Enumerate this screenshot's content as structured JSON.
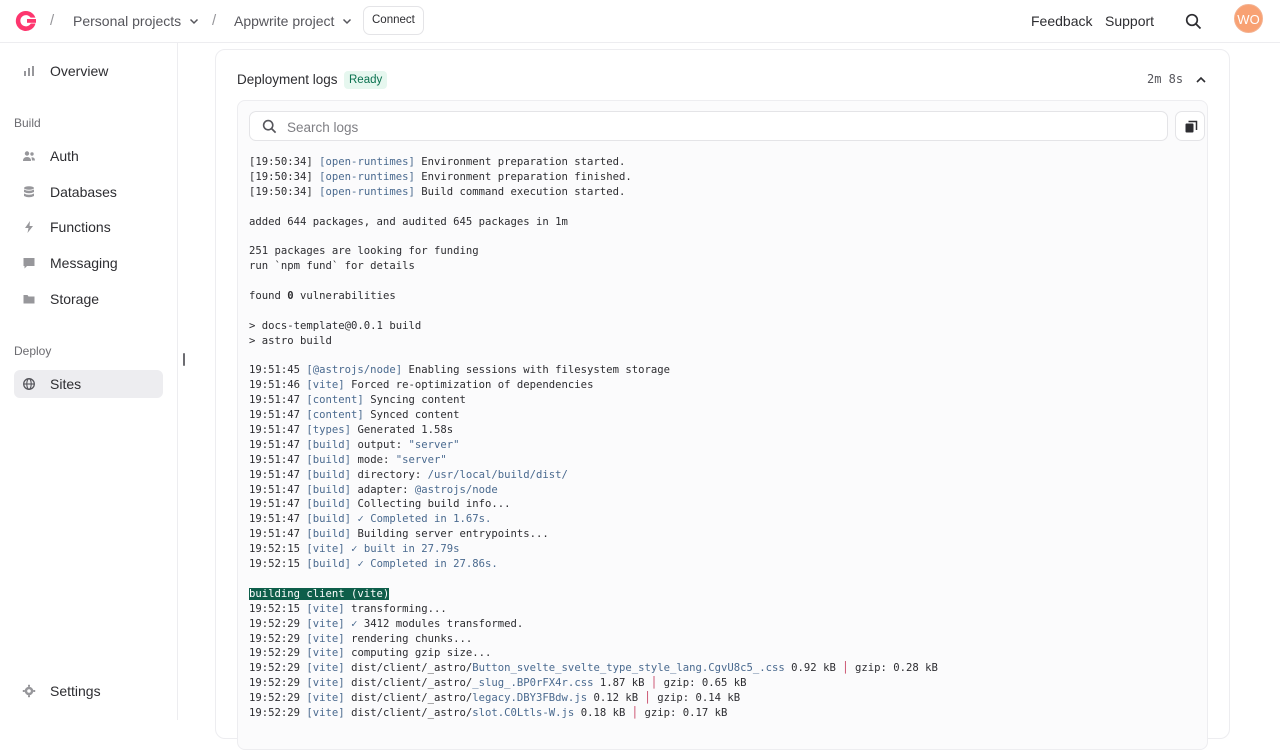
{
  "header": {
    "crumbs": [
      "Personal projects",
      "Appwrite project"
    ],
    "connect_label": "Connect",
    "feedback": "Feedback",
    "support": "Support",
    "avatar_initials": "WO"
  },
  "sidebar": {
    "overview": "Overview",
    "build_section": "Build",
    "items": [
      "Auth",
      "Databases",
      "Functions",
      "Messaging",
      "Storage"
    ],
    "deploy_section": "Deploy",
    "sites": "Sites",
    "settings": "Settings"
  },
  "deployment": {
    "title": "Deployment logs",
    "status": "Ready",
    "duration": "2m 8s",
    "search_placeholder": "Search logs"
  },
  "logs": [
    {
      "ts": "[19:50:34]",
      "tag": "[open-runtimes]",
      "msg": "Environment preparation started."
    },
    {
      "ts": "[19:50:34]",
      "tag": "[open-runtimes]",
      "msg": "Environment preparation finished."
    },
    {
      "ts": "[19:50:34]",
      "tag": "[open-runtimes]",
      "msg": "Build command execution started."
    },
    {
      "blank": true
    },
    {
      "msg": "added 644 packages, and audited 645 packages in 1m"
    },
    {
      "blank": true
    },
    {
      "msg": "251 packages are looking for funding"
    },
    {
      "msg": "run `npm fund` for details"
    },
    {
      "blank": true
    },
    {
      "msg": "found ",
      "bold": "0",
      "msg2": " vulnerabilities"
    },
    {
      "blank": true
    },
    {
      "msg": "> docs-template@0.0.1 build"
    },
    {
      "msg": "> astro build"
    },
    {
      "blank": true
    },
    {
      "ts": "19:51:45",
      "tag": "[@astrojs/node]",
      "msg": "Enabling sessions with filesystem storage"
    },
    {
      "ts": "19:51:46",
      "tag": "[vite]",
      "msg": "Forced re-optimization of dependencies"
    },
    {
      "ts": "19:51:47",
      "tag": "[content]",
      "msg": "Syncing content"
    },
    {
      "ts": "19:51:47",
      "tag": "[content]",
      "msg": "Synced content"
    },
    {
      "ts": "19:51:47",
      "tag": "[types]",
      "msg": "Generated 1.58s"
    },
    {
      "ts": "19:51:47",
      "tag": "[build]",
      "msg": "output: ",
      "path": "\"server\""
    },
    {
      "ts": "19:51:47",
      "tag": "[build]",
      "msg": "mode: ",
      "path": "\"server\""
    },
    {
      "ts": "19:51:47",
      "tag": "[build]",
      "msg": "directory: ",
      "path": "/usr/local/build/dist/"
    },
    {
      "ts": "19:51:47",
      "tag": "[build]",
      "msg": "adapter: ",
      "path": "@astrojs/node"
    },
    {
      "ts": "19:51:47",
      "tag": "[build]",
      "msg": "Collecting build info..."
    },
    {
      "ts": "19:51:47",
      "tag": "[build]",
      "msg": "",
      "path": "✓ Completed in 1.67s."
    },
    {
      "ts": "19:51:47",
      "tag": "[build]",
      "msg": "Building server entrypoints..."
    },
    {
      "ts": "19:52:15",
      "tag": "[vite]",
      "msg": "",
      "path": "✓ built in 27.79s"
    },
    {
      "ts": "19:52:15",
      "tag": "[build]",
      "msg": "",
      "path": "✓ Completed in 27.86s."
    },
    {
      "blank": true
    },
    {
      "highlight": "building client (vite)"
    },
    {
      "ts": "19:52:15",
      "tag": "[vite]",
      "msg": "transforming..."
    },
    {
      "ts": "19:52:29",
      "tag": "[vite]",
      "msg": "",
      "path": "✓",
      "msg2": " 3412 modules transformed."
    },
    {
      "ts": "19:52:29",
      "tag": "[vite]",
      "msg": "rendering chunks..."
    },
    {
      "ts": "19:52:29",
      "tag": "[vite]",
      "msg": "computing gzip size..."
    },
    {
      "ts": "19:52:29",
      "tag": "[vite]",
      "msg": "dist/client/_astro/",
      "path": "Button_svelte_svelte_type_style_lang.CgvU8c5_.css",
      "size": " 0.92 kB ",
      "gzip": " gzip: 0.28 kB"
    },
    {
      "ts": "19:52:29",
      "tag": "[vite]",
      "msg": "dist/client/_astro/",
      "path": "_slug_.BP0rFX4r.css",
      "size": " 1.87 kB ",
      "gzip": " gzip: 0.65 kB"
    },
    {
      "ts": "19:52:29",
      "tag": "[vite]",
      "msg": "dist/client/_astro/",
      "path": "legacy.DBY3FBdw.js",
      "size": " 0.12 kB ",
      "gzip": " gzip: 0.14 kB"
    },
    {
      "ts": "19:52:29",
      "tag": "[vite]",
      "msg": "dist/client/_astro/",
      "path": "slot.C0Ltls-W.js",
      "size": " 0.18 kB ",
      "gzip": " gzip: 0.17 kB"
    }
  ]
}
